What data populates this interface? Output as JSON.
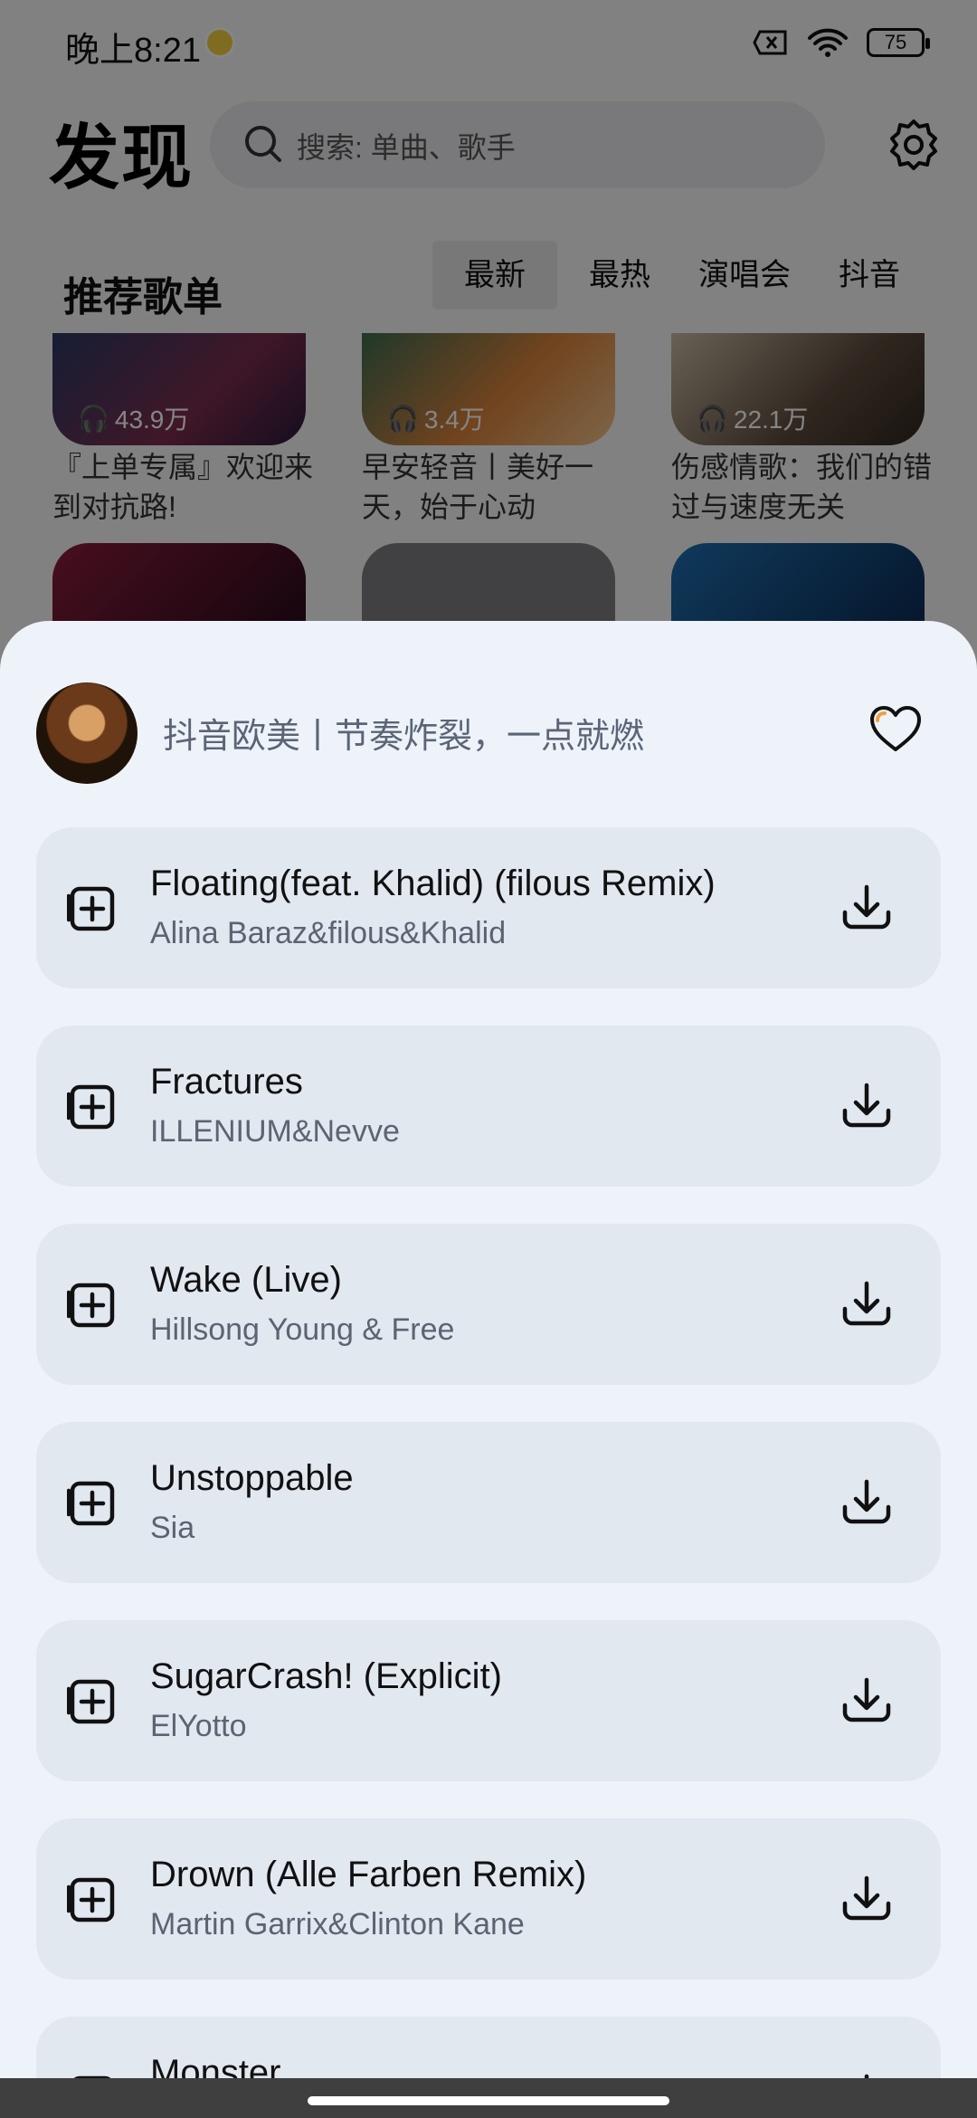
{
  "status": {
    "time": "晚上8:21",
    "battery": "75"
  },
  "header": {
    "brand": "发现",
    "search_placeholder": "搜索: 单曲、歌手"
  },
  "section": {
    "title": "推荐歌单",
    "tabs": [
      "最新",
      "最热",
      "演唱会",
      "抖音"
    ]
  },
  "cards": [
    {
      "count": "43.9万",
      "title": "『上单专属』欢迎来到对抗路!"
    },
    {
      "count": "3.4万",
      "title": "早安轻音丨美好一天，始于心动"
    },
    {
      "count": "22.1万",
      "title": "伤感情歌：我们的错过与速度无关"
    }
  ],
  "sheet": {
    "playlist_title": "抖音欧美丨节奏炸裂，一点就燃",
    "songs": [
      {
        "title": "Floating(feat. Khalid) (filous Remix)",
        "artist": "Alina Baraz&filous&Khalid"
      },
      {
        "title": "Fractures",
        "artist": "ILLENIUM&Nevve"
      },
      {
        "title": "Wake (Live)",
        "artist": "Hillsong Young & Free"
      },
      {
        "title": "Unstoppable",
        "artist": "Sia"
      },
      {
        "title": "SugarCrash! (Explicit)",
        "artist": "ElYotto"
      },
      {
        "title": "Drown (Alle Farben Remix)",
        "artist": "Martin Garrix&Clinton Kane"
      },
      {
        "title": "Monster",
        "artist": ""
      }
    ]
  },
  "colors": {
    "sheet_bg": "#eef3f9",
    "row_bg": "#e2e8f0",
    "overlay": "rgba(0,0,0,0.48)"
  }
}
